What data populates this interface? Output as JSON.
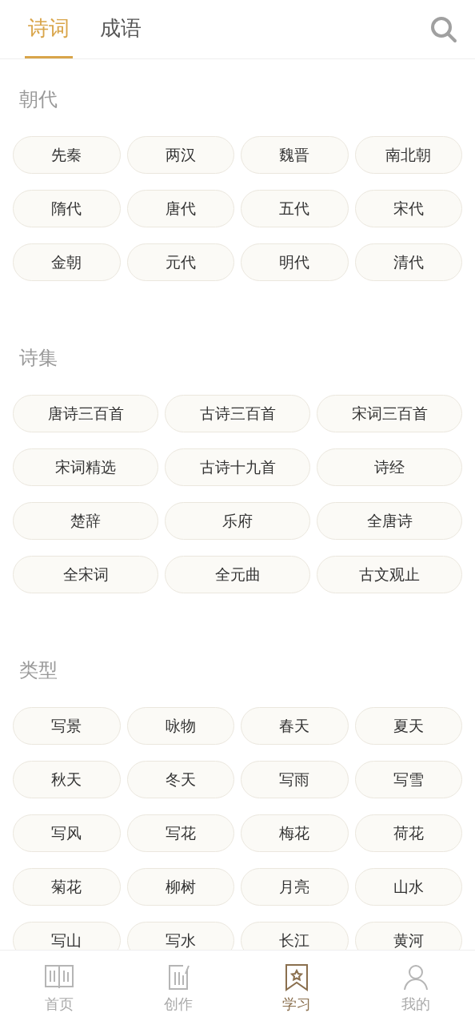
{
  "tabs": [
    {
      "label": "诗词",
      "selected": true
    },
    {
      "label": "成语",
      "selected": false
    }
  ],
  "sections": [
    {
      "title": "朝代",
      "kind": "short",
      "items": [
        "先秦",
        "两汉",
        "魏晋",
        "南北朝",
        "隋代",
        "唐代",
        "五代",
        "宋代",
        "金朝",
        "元代",
        "明代",
        "清代"
      ]
    },
    {
      "title": "诗集",
      "kind": "long",
      "items": [
        "唐诗三百首",
        "古诗三百首",
        "宋词三百首",
        "宋词精选",
        "古诗十九首",
        "诗经",
        "楚辞",
        "乐府",
        "全唐诗",
        "全宋词",
        "全元曲",
        "古文观止"
      ]
    },
    {
      "title": "类型",
      "kind": "short",
      "items": [
        "写景",
        "咏物",
        "春天",
        "夏天",
        "秋天",
        "冬天",
        "写雨",
        "写雪",
        "写风",
        "写花",
        "梅花",
        "荷花",
        "菊花",
        "柳树",
        "月亮",
        "山水",
        "写山",
        "写水",
        "长江",
        "黄河"
      ]
    }
  ],
  "nav": [
    {
      "label": "首页",
      "selected": false,
      "kind": "book"
    },
    {
      "label": "创作",
      "selected": false,
      "kind": "write"
    },
    {
      "label": "学习",
      "selected": true,
      "kind": "bookmark"
    },
    {
      "label": "我的",
      "selected": false,
      "kind": "person"
    }
  ]
}
